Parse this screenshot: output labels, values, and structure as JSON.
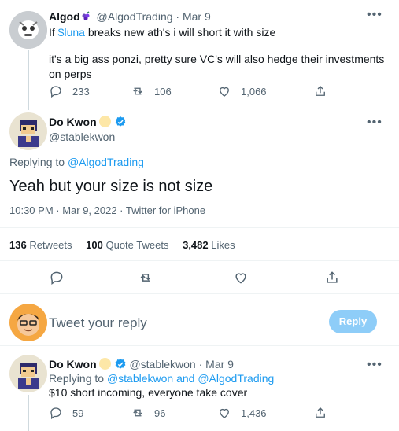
{
  "tweet1": {
    "display_name": "Algod",
    "handle": "@AlgodTrading",
    "separator": "·",
    "date": "Mar 9",
    "text_before": "If ",
    "cashtag": "$luna",
    "text_after": " breaks new ath's i will short it with size",
    "text_para2": "it's a big ass ponzi, pretty sure VC's will also hedge their investments on perps",
    "replies": "233",
    "retweets": "106",
    "likes": "1,066"
  },
  "main_tweet": {
    "display_name": "Do Kwon",
    "handle": "@stablekwon",
    "replying_prefix": "Replying to ",
    "replying_to": "@AlgodTrading",
    "text": "Yeah but your size is not size",
    "timestamp": "10:30 PM · Mar 9, 2022 · Twitter for iPhone",
    "retweets_count": "136",
    "retweets_label": "Retweets",
    "quote_count": "100",
    "quote_label": "Quote Tweets",
    "likes_count": "3,482",
    "likes_label": "Likes"
  },
  "reply_box": {
    "placeholder": "Tweet your reply",
    "button_label": "Reply"
  },
  "tweet3": {
    "display_name": "Do Kwon",
    "handle": "@stablekwon",
    "separator": "·",
    "date": "Mar 9",
    "replying_prefix": "Replying to ",
    "replying_to": "@stablekwon and @AlgodTrading",
    "text": "$10 short incoming, everyone take cover",
    "replies": "59",
    "retweets": "96",
    "likes": "1,436"
  },
  "colors": {
    "accent": "#1d9bf0",
    "muted": "#536471",
    "reply_button_disabled": "#8ecdf8"
  }
}
